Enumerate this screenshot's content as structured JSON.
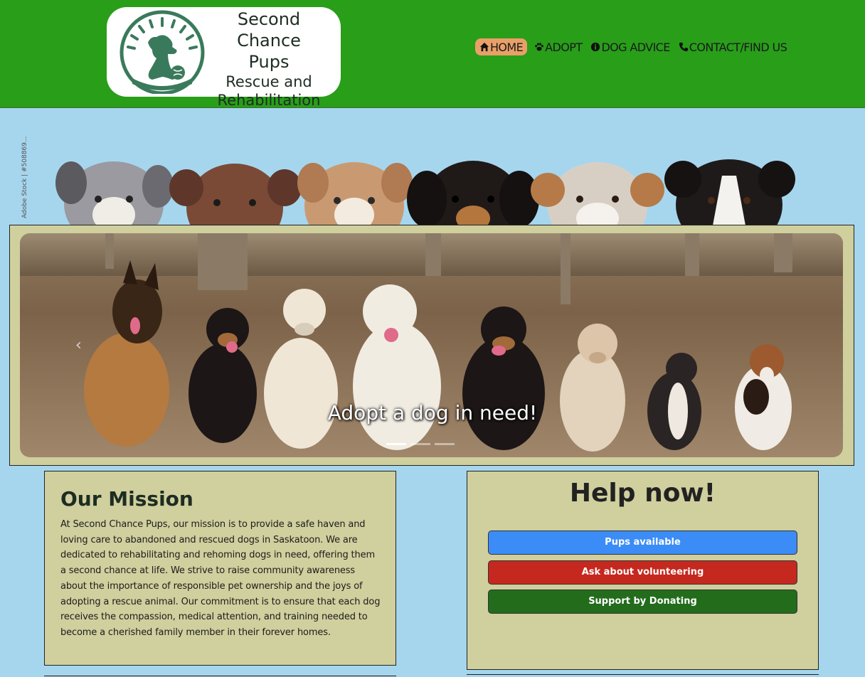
{
  "logo": {
    "line1": "Second Chance",
    "line2": "Pups",
    "line3": "Rescue and",
    "line4": "Rehabilitation",
    "emblem_icon": "dog-sunburst-logo-icon"
  },
  "nav": {
    "items": [
      {
        "label": "HOME",
        "icon": "home-icon",
        "active": true
      },
      {
        "label": "ADOPT",
        "icon": "paw-icon",
        "active": false
      },
      {
        "label": "DOG ADVICE",
        "icon": "info-icon",
        "active": false
      },
      {
        "label": "CONTACT/FIND US",
        "icon": "phone-icon",
        "active": false
      }
    ]
  },
  "hero": {
    "stock_credit": "Adobe Stock | #508869..."
  },
  "carousel": {
    "caption": "Adopt a dog in need!",
    "prev_icon": "chevron-left-icon",
    "slide_count": 3,
    "active_slide": 1
  },
  "mission": {
    "title": "Our Mission",
    "body": "At Second Chance Pups, our mission is to provide a safe haven and loving care to abandoned and rescued dogs in Saskatoon. We are dedicated to rehabilitating and rehoming dogs in need, offering them a second chance at life. We strive to raise community awareness about the importance of responsible pet ownership and the joys of adopting a rescue animal. Our commitment is to ensure that each dog receives the compassion, medical attention, and training needed to become a cherished family member in their forever homes."
  },
  "help": {
    "title": "Help now!",
    "buttons": [
      {
        "label": "Pups available",
        "color": "#3b8cf7"
      },
      {
        "label": "Ask about volunteering",
        "color": "#c5281f"
      },
      {
        "label": "Support by Donating",
        "color": "#226c1c"
      }
    ]
  },
  "colors": {
    "header": "#289e19",
    "page_bg": "#a6d6ee",
    "panel_bg": "#d0cf9e",
    "nav_active": "#e9a068"
  }
}
